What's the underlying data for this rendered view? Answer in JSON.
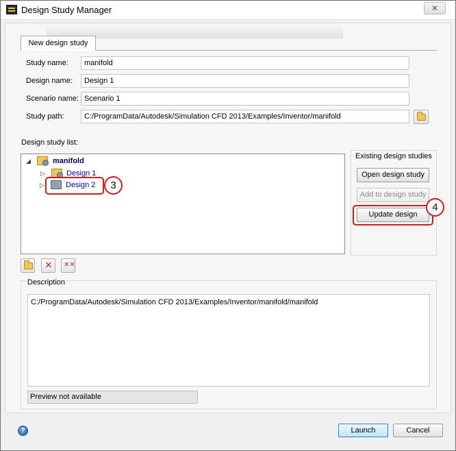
{
  "window": {
    "title": "Design Study Manager",
    "close_glyph": "✕"
  },
  "tabs": [
    {
      "label": "New design study"
    }
  ],
  "form": {
    "study_name": {
      "label": "Study name:",
      "value": "manifold"
    },
    "design_name": {
      "label": "Design name:",
      "value": "Design 1"
    },
    "scenario_name": {
      "label": "Scenario name:",
      "value": "Scenario 1"
    },
    "study_path": {
      "label": "Study path:",
      "value": "C:/ProgramData/Autodesk/Simulation CFD 2013/Examples/Inventor/manifold"
    }
  },
  "design_list": {
    "label": "Design study list:",
    "root": {
      "label": "manifold",
      "icon": "study-folder-icon",
      "expanded": true
    },
    "items": [
      {
        "label": "Design 1",
        "icon": "design-folder-icon"
      },
      {
        "label": "Design 2",
        "icon": "design-gear-icon",
        "selected": true
      }
    ]
  },
  "existing": {
    "caption": "Existing design studies",
    "buttons": [
      {
        "label": "Open design study",
        "enabled": true
      },
      {
        "label": "Add to design study",
        "enabled": false
      },
      {
        "label": "Update design",
        "enabled": true
      }
    ]
  },
  "list_tools": [
    {
      "name": "open-folder-icon"
    },
    {
      "name": "delete-icon"
    },
    {
      "name": "delete-all-icon"
    }
  ],
  "description": {
    "caption": "Description",
    "text": "C:/ProgramData/Autodesk/Simulation CFD 2013/Examples/Inventor/manifold/manifold",
    "preview": "Preview not available"
  },
  "footer": {
    "help_glyph": "?",
    "launch": "Launch",
    "cancel": "Cancel"
  },
  "callouts": [
    {
      "number": "3"
    },
    {
      "number": "4"
    }
  ],
  "colors": {
    "callout": "#d91a1a",
    "link": "#0000cc",
    "default_button": "#3c7fb1"
  }
}
